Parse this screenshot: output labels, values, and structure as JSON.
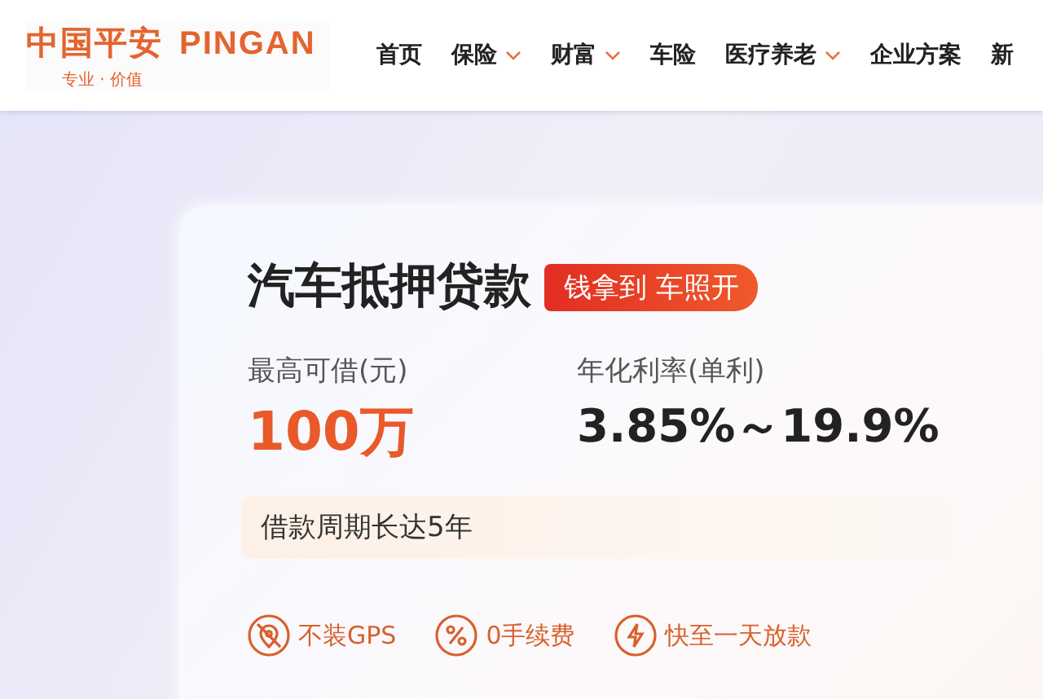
{
  "header": {
    "logo": {
      "cn": "中国平安",
      "en": "PINGAN",
      "slogan": "专业 · 价值"
    },
    "nav": [
      {
        "label": "首页",
        "dropdown": false
      },
      {
        "label": "保险",
        "dropdown": true
      },
      {
        "label": "财富",
        "dropdown": true
      },
      {
        "label": "车险",
        "dropdown": false
      },
      {
        "label": "医疗养老",
        "dropdown": true
      },
      {
        "label": "企业方案",
        "dropdown": false
      },
      {
        "label": "新",
        "dropdown": false
      }
    ]
  },
  "card": {
    "title": "汽车抵押贷款",
    "badge": "钱拿到 车照开",
    "stats": [
      {
        "label": "最高可借(元)",
        "value": "100万",
        "kind": "highlight"
      },
      {
        "label": "年化利率(单利)",
        "value": "3.85%～19.9%",
        "kind": "plain"
      }
    ],
    "note": "借款周期长达5年",
    "features": [
      {
        "kind": "gps",
        "label": "不装GPS"
      },
      {
        "kind": "fee",
        "label": "0手续费"
      },
      {
        "kind": "speed",
        "label": "快至一天放款"
      }
    ]
  }
}
